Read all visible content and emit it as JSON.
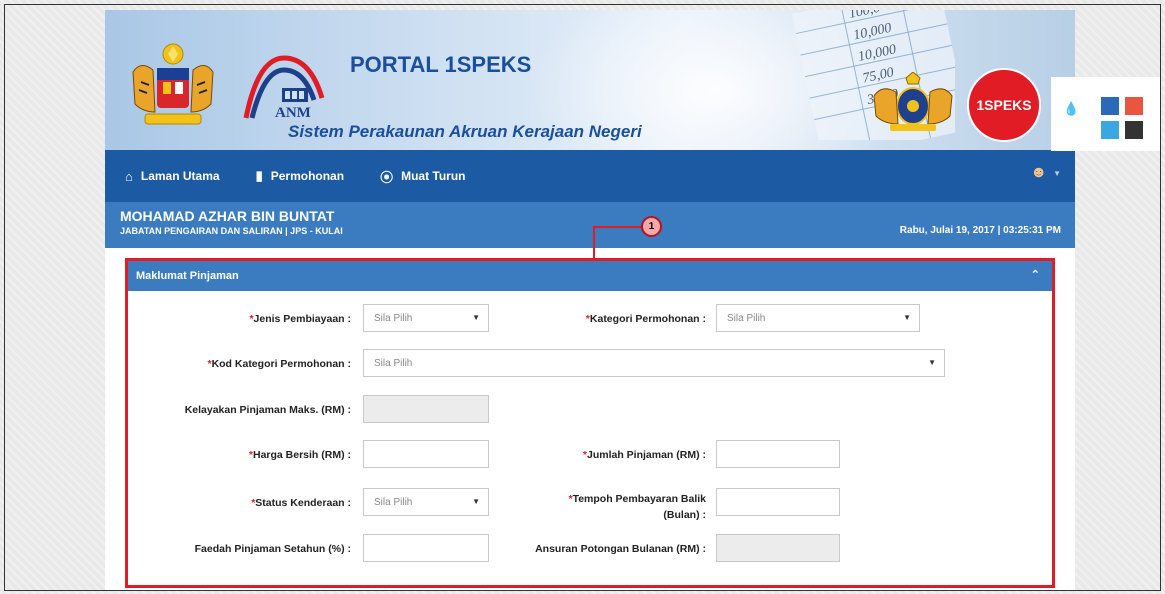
{
  "banner": {
    "title": "PORTAL 1SPEKS",
    "subtitle": "Sistem Perakaunan Akruan Kerajaan Negeri",
    "anm_label": "ANM",
    "badge_label": "1SPEKS",
    "sheet_values": [
      "100,0",
      "10,000",
      "10,000",
      "75,00",
      "306,0"
    ]
  },
  "nav": {
    "items": [
      {
        "label": "Laman Utama",
        "icon": "home-icon"
      },
      {
        "label": "Permohonan",
        "icon": "book-icon"
      },
      {
        "label": "Muat Turun",
        "icon": "download-icon"
      }
    ]
  },
  "user": {
    "name": "MOHAMAD AZHAR BIN BUNTAT",
    "department": "JABATAN PENGAIRAN DAN SALIRAN | JPS - KULAI",
    "datetime": "Rabu, Julai 19, 2017 | 03:25:31 PM"
  },
  "callout": {
    "number": "1"
  },
  "panel": {
    "title": "Maklumat Pinjaman",
    "fields": {
      "jenis_pembiayaan": {
        "label": "Jenis Pembiayaan :",
        "required": "*",
        "value": "Sila Pilih"
      },
      "kategori_permohonan": {
        "label": "Kategori Permohonan :",
        "required": "*",
        "value": "Sila Pilih"
      },
      "kod_kategori": {
        "label": "Kod Kategori Permohonan :",
        "required": "*",
        "value": "Sila Pilih"
      },
      "kelayakan": {
        "label": "Kelayakan Pinjaman Maks. (RM) :",
        "value": ""
      },
      "harga_bersih": {
        "label": "Harga Bersih (RM) :",
        "required": "*",
        "value": ""
      },
      "jumlah_pinjaman": {
        "label": "Jumlah Pinjaman (RM) :",
        "required": "*",
        "value": ""
      },
      "status_kenderaan": {
        "label": "Status Kenderaan :",
        "required": "*",
        "value": "Sila Pilih"
      },
      "tempoh": {
        "label": "Tempoh Pembayaran Balik",
        "label2": "(Bulan) :",
        "required": "*",
        "value": ""
      },
      "faedah": {
        "label": "Faedah Pinjaman Setahun (%) :",
        "value": ""
      },
      "ansuran": {
        "label": "Ansuran Potongan Bulanan (RM) :",
        "value": ""
      }
    }
  },
  "theme_colors": [
    "#2a6ab8",
    "#e8563f",
    "#3aa7e0",
    "#333333"
  ]
}
